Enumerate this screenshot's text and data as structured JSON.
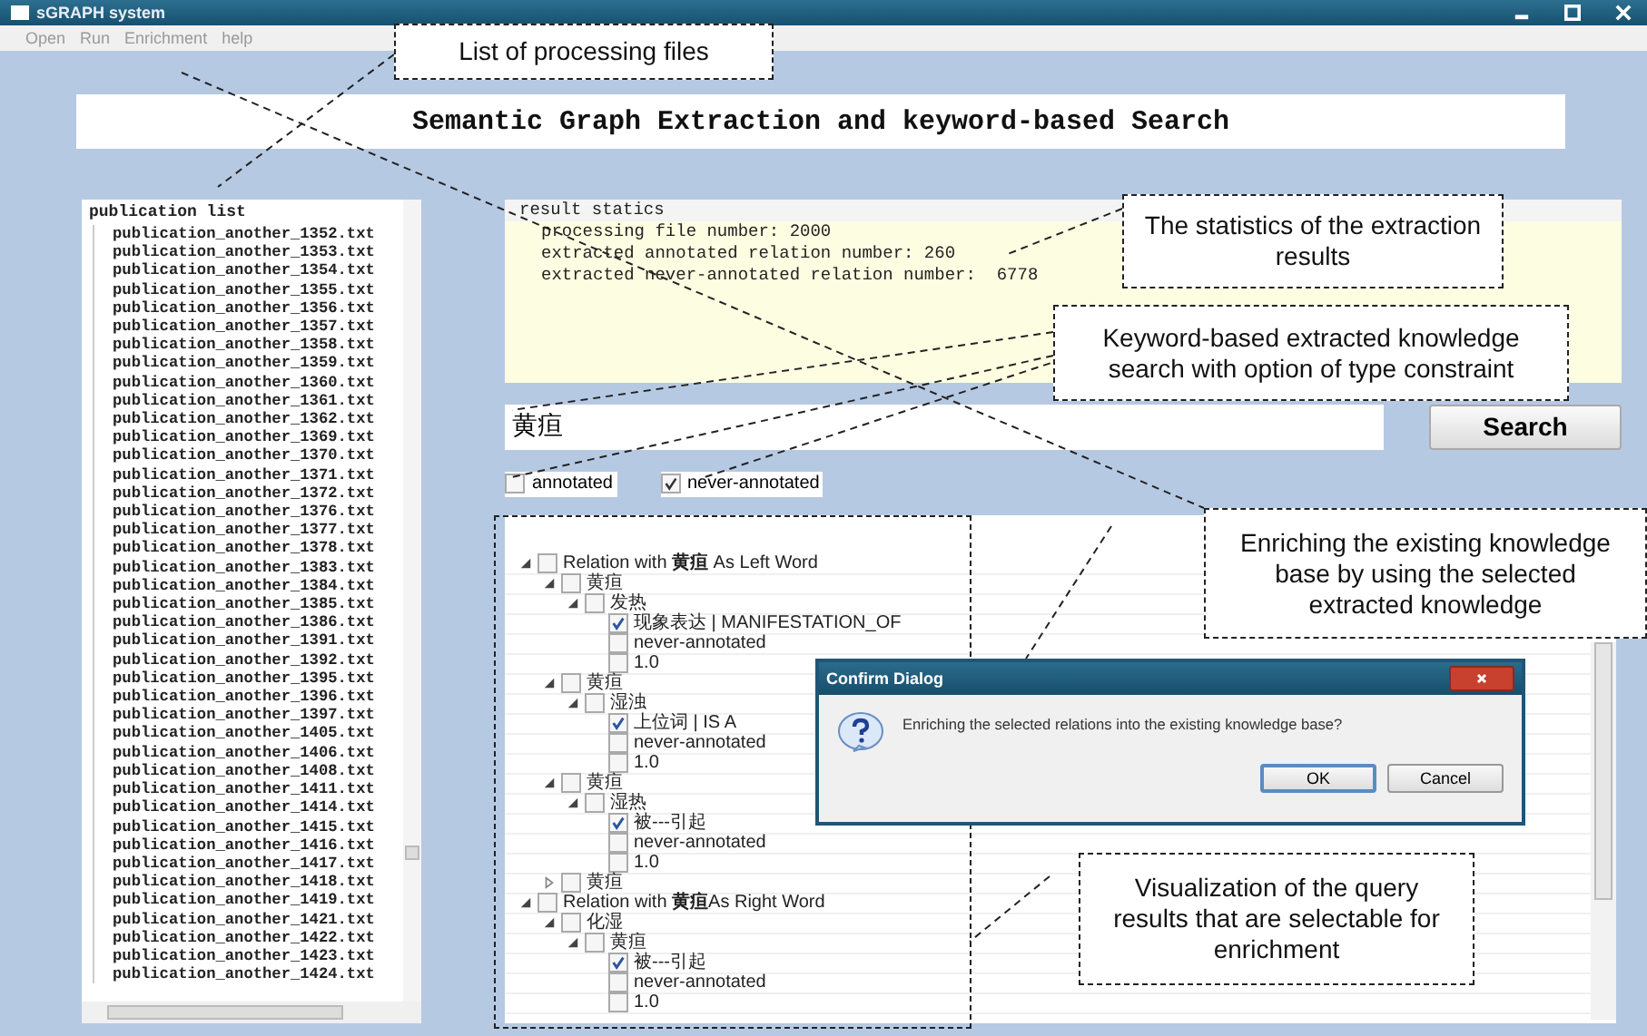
{
  "window": {
    "title": "sGRAPH system"
  },
  "menu": [
    "Open",
    "Run",
    "Enrichment",
    "help"
  ],
  "banner": "Semantic Graph Extraction and keyword-based Search",
  "file_list": {
    "title": "publication list",
    "items": [
      "publication_another_1352.txt",
      "publication_another_1353.txt",
      "publication_another_1354.txt",
      "publication_another_1355.txt",
      "publication_another_1356.txt",
      "publication_another_1357.txt",
      "publication_another_1358.txt",
      "publication_another_1359.txt",
      "publication_another_1360.txt",
      "publication_another_1361.txt",
      "publication_another_1362.txt",
      "publication_another_1369.txt",
      "publication_another_1370.txt",
      "publication_another_1371.txt",
      "publication_another_1372.txt",
      "publication_another_1376.txt",
      "publication_another_1377.txt",
      "publication_another_1378.txt",
      "publication_another_1383.txt",
      "publication_another_1384.txt",
      "publication_another_1385.txt",
      "publication_another_1386.txt",
      "publication_another_1391.txt",
      "publication_another_1392.txt",
      "publication_another_1395.txt",
      "publication_another_1396.txt",
      "publication_another_1397.txt",
      "publication_another_1405.txt",
      "publication_another_1406.txt",
      "publication_another_1408.txt",
      "publication_another_1411.txt",
      "publication_another_1414.txt",
      "publication_another_1415.txt",
      "publication_another_1416.txt",
      "publication_another_1417.txt",
      "publication_another_1418.txt",
      "publication_another_1419.txt",
      "publication_another_1421.txt",
      "publication_another_1422.txt",
      "publication_another_1423.txt",
      "publication_another_1424.txt"
    ]
  },
  "results": {
    "title": "result statics",
    "lines": [
      "processing file number: 2000",
      "extracted annotated relation number: 260",
      "extracted never-annotated relation number:  6778"
    ]
  },
  "search": {
    "value": "黄疸",
    "button": "Search"
  },
  "filters": [
    {
      "label": "annotated",
      "checked": false
    },
    {
      "label": "never-annotated",
      "checked": true
    }
  ],
  "tree": [
    {
      "label": "Relation with **黄疸** As Left Word",
      "checked": false,
      "expanded": true,
      "children": [
        {
          "label": "黄疸",
          "checked": false,
          "expanded": true,
          "children": [
            {
              "label": "发热",
              "checked": false,
              "expanded": true,
              "children": [
                {
                  "label": "现象表达 | MANIFESTATION_OF",
                  "checked": true
                },
                {
                  "label": "never-annotated",
                  "checked": false
                },
                {
                  "label": "1.0",
                  "checked": false
                }
              ]
            }
          ]
        },
        {
          "label": "黄疸",
          "checked": false,
          "expanded": true,
          "children": [
            {
              "label": "湿浊",
              "checked": false,
              "expanded": true,
              "children": [
                {
                  "label": "上位词 | IS A",
                  "checked": true
                },
                {
                  "label": "never-annotated",
                  "checked": false
                },
                {
                  "label": "1.0",
                  "checked": false
                }
              ]
            }
          ]
        },
        {
          "label": "黄疸",
          "checked": false,
          "expanded": true,
          "children": [
            {
              "label": "湿热",
              "checked": false,
              "expanded": true,
              "children": [
                {
                  "label": "被---引起",
                  "checked": true
                },
                {
                  "label": "never-annotated",
                  "checked": false
                },
                {
                  "label": "1.0",
                  "checked": false
                }
              ]
            }
          ]
        },
        {
          "label": "黄疸",
          "checked": false,
          "expanded": false
        }
      ]
    },
    {
      "label": "Relation with **黄疸**As Right Word",
      "checked": false,
      "expanded": true,
      "children": [
        {
          "label": "化湿",
          "checked": false,
          "expanded": true,
          "children": [
            {
              "label": "黄疸",
              "checked": false,
              "expanded": true,
              "children": [
                {
                  "label": "被---引起",
                  "checked": true
                },
                {
                  "label": "never-annotated",
                  "checked": false
                },
                {
                  "label": "1.0",
                  "checked": false
                }
              ]
            }
          ]
        }
      ]
    }
  ],
  "dialog": {
    "title": "Confirm Dialog",
    "message": "Enriching the selected relations into the existing knowledge base?",
    "buttons": [
      "OK",
      "Cancel"
    ]
  },
  "callouts": [
    "List of processing files",
    "The statistics of the extraction results",
    "Keyword-based extracted knowledge search with option of type constraint",
    "Enriching the existing knowledge base by using the selected extracted knowledge",
    "Visualization of the query results that are selectable for enrichment"
  ]
}
